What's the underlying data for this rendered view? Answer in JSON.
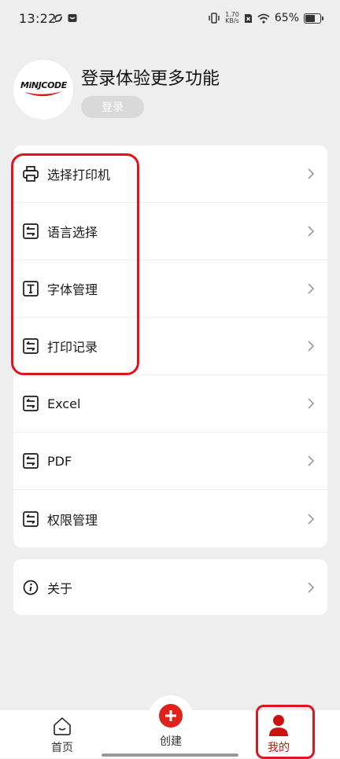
{
  "status_bar": {
    "time": "13:22",
    "net_speed_value": "1.70",
    "net_speed_unit": "KB/s",
    "battery_percent": "65%"
  },
  "profile": {
    "logo_text": "MiNJCODE",
    "title": "登录体验更多功能",
    "login_button": "登录"
  },
  "menu": {
    "items": [
      {
        "label": "选择打印机",
        "icon": "printer-icon"
      },
      {
        "label": "语言选择",
        "icon": "swap-icon"
      },
      {
        "label": "字体管理",
        "icon": "text-icon"
      },
      {
        "label": "打印记录",
        "icon": "swap-icon"
      },
      {
        "label": "Excel",
        "icon": "swap-icon"
      },
      {
        "label": "PDF",
        "icon": "swap-icon"
      },
      {
        "label": "权限管理",
        "icon": "swap-icon"
      }
    ]
  },
  "about": {
    "label": "关于",
    "icon": "info-icon"
  },
  "tabbar": {
    "home": "首页",
    "create": "创建",
    "mine": "我的",
    "active": "mine"
  },
  "colors": {
    "accent": "#e0201b",
    "annotation": "#e2141b",
    "background": "#eeeeee",
    "card": "#ffffff",
    "login_button": "#d9d9d9"
  }
}
